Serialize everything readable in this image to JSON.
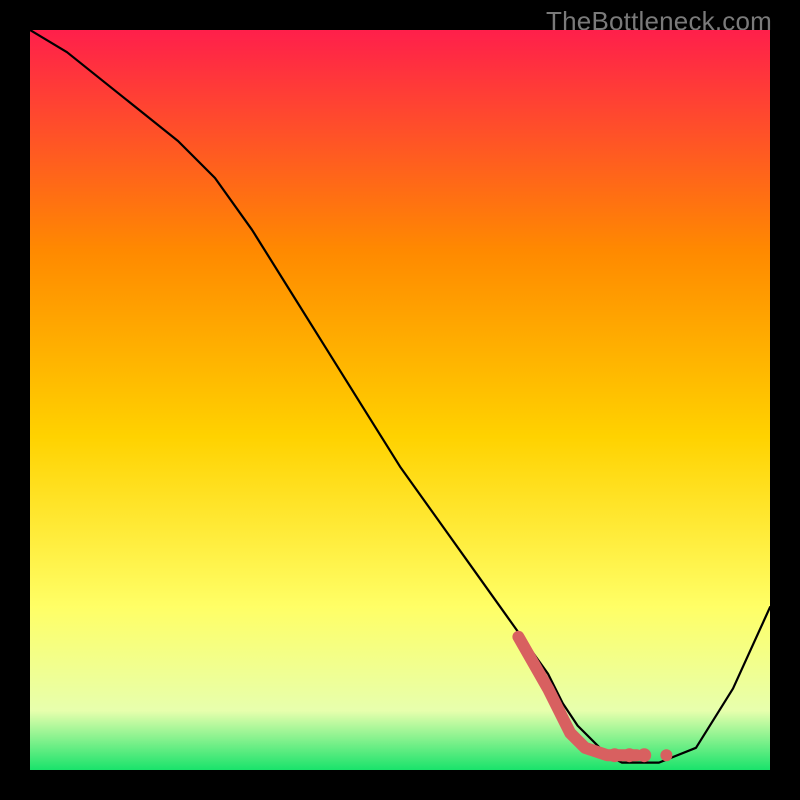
{
  "watermark": "TheBottleneck.com",
  "colors": {
    "bg": "#000000",
    "gradient_top": "#ff1f4b",
    "gradient_mid1": "#ff8a00",
    "gradient_mid2": "#ffd200",
    "gradient_mid3": "#ffff66",
    "gradient_low": "#e7ffad",
    "gradient_bottom": "#19e36b",
    "curve": "#000000",
    "highlight": "#d86060"
  },
  "chart_data": {
    "type": "line",
    "title": "",
    "xlabel": "",
    "ylabel": "",
    "xlim": [
      0,
      100
    ],
    "ylim": [
      0,
      100
    ],
    "x": [
      0,
      5,
      10,
      15,
      20,
      25,
      30,
      35,
      40,
      45,
      50,
      55,
      60,
      65,
      70,
      72,
      74,
      76,
      78,
      80,
      82,
      85,
      90,
      95,
      100
    ],
    "values": [
      100,
      97,
      93,
      89,
      85,
      80,
      73,
      65,
      57,
      49,
      41,
      34,
      27,
      20,
      13,
      9,
      6,
      4,
      2,
      1,
      1,
      1,
      3,
      11,
      22
    ],
    "highlight_segment": {
      "x": [
        66,
        70,
        73,
        75,
        78,
        80,
        82
      ],
      "y": [
        18,
        11,
        5,
        3,
        2,
        2,
        2
      ]
    },
    "highlight_dots": {
      "x": [
        79,
        81,
        83,
        86
      ],
      "y": [
        2,
        2,
        2,
        2
      ]
    }
  }
}
